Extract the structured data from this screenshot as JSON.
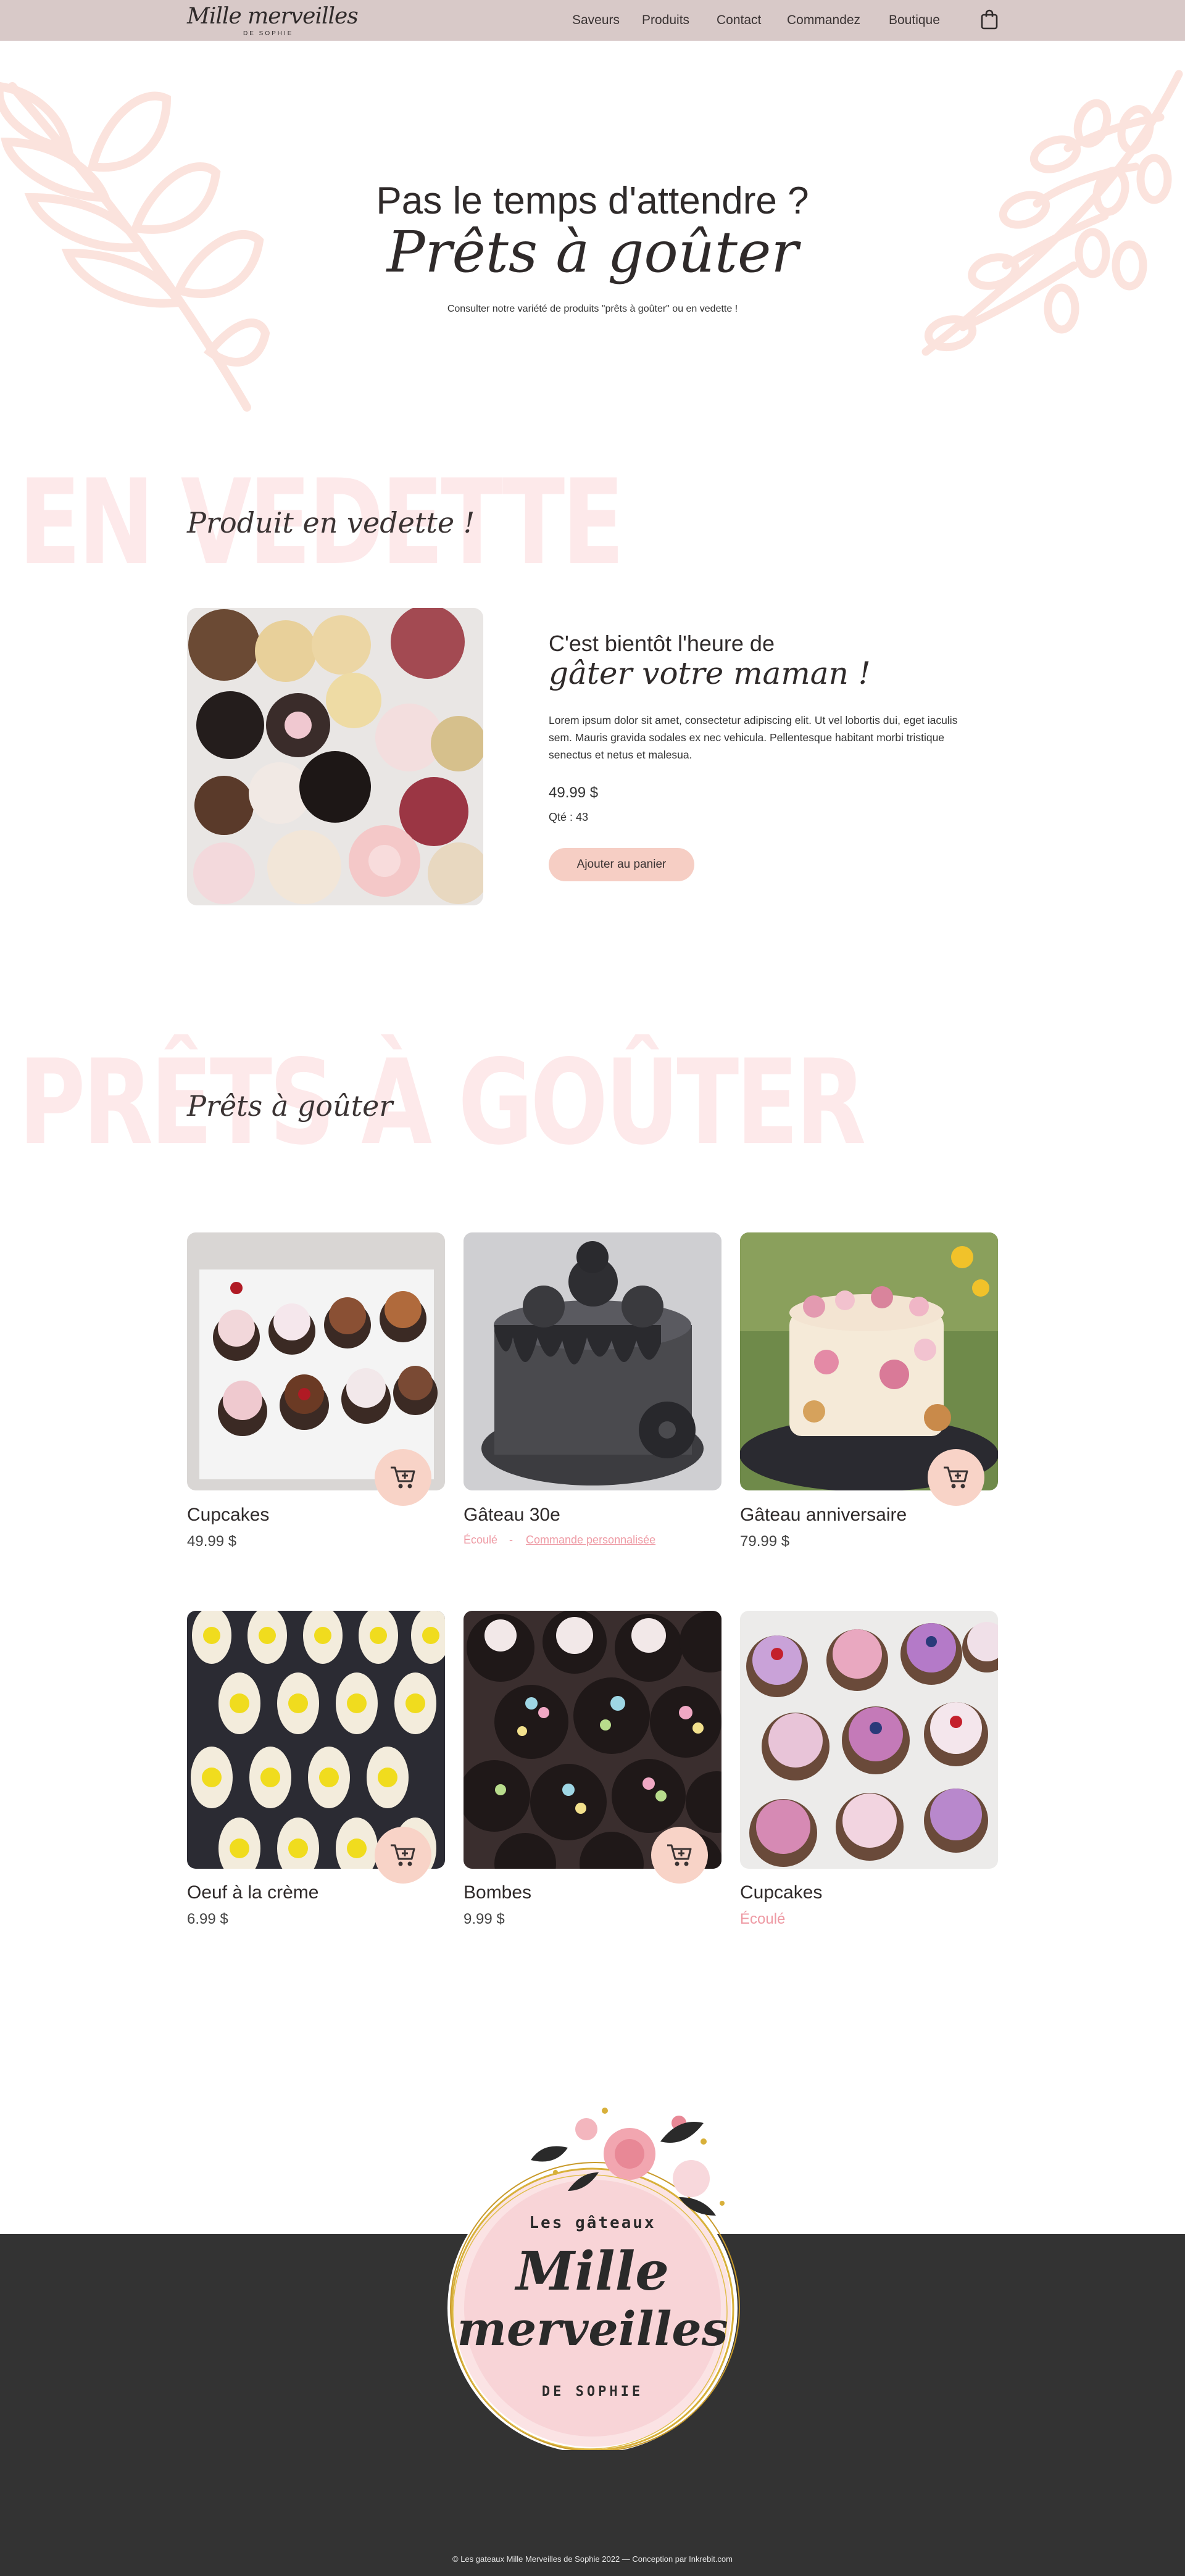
{
  "brand": {
    "name": "Mille merveilles",
    "subtitle": "DE SOPHIE"
  },
  "nav": {
    "items": [
      "Saveurs",
      "Produits",
      "Contact",
      "Commandez",
      "Boutique"
    ],
    "cart_icon": "shopping-bag-icon"
  },
  "hero": {
    "line1": "Pas le temps d'attendre ?",
    "line2": "Prêts à goûter",
    "description": "Consulter notre variété de produits \"prêts à goûter\" ou en vedette !"
  },
  "featured": {
    "bg_title": "EN VEDETTE",
    "script_title": "Produit en vedette !",
    "heading_line1": "C'est bientôt l'heure de",
    "heading_line2": "gâter votre maman !",
    "description": "Lorem ipsum dolor sit amet, consectetur adipiscing elit. Ut vel lobortis dui, eget iaculis sem. Mauris gravida sodales ex nec vehicula. Pellentesque habitant morbi tristique senectus et netus et malesua.",
    "price": "49.99 $",
    "quantity": "Qté : 43",
    "button_label": "Ajouter au panier"
  },
  "ready": {
    "bg_title": "PRÊTS À GOÛTER",
    "script_title": "Prêts à goûter",
    "products": [
      {
        "name": "Cupcakes",
        "price": "49.99 $",
        "cart_icon": "add-to-cart-icon"
      },
      {
        "name": "Gâteau 30e",
        "sold_out": "Écoulé",
        "separator": "-",
        "custom_order": "Commande personnalisée"
      },
      {
        "name": "Gâteau anniversaire",
        "price": "79.99 $",
        "cart_icon": "add-to-cart-icon"
      },
      {
        "name": "Oeuf à la crème",
        "price": "6.99 $",
        "cart_icon": "add-to-cart-icon"
      },
      {
        "name": "Bombes",
        "price": "9.99 $",
        "cart_icon": "add-to-cart-icon"
      },
      {
        "name": "Cupcakes",
        "sold_out": "Écoulé"
      }
    ]
  },
  "footer_logo": {
    "top": "Les gâteaux",
    "line1": "Mille",
    "line2": "merveilles",
    "bottom": "DE SOPHIE"
  },
  "footer": {
    "copyright": "© Les gateaux Mille Merveilles de Sophie 2022 — Conception par Inkrebit.com"
  },
  "colors": {
    "nav_bg": "#d8c9c8",
    "accent_pink": "#f6cec4",
    "sold_out": "#ee9aa4",
    "footer_bg": "#333333",
    "bg_title": "#fde9ea"
  }
}
